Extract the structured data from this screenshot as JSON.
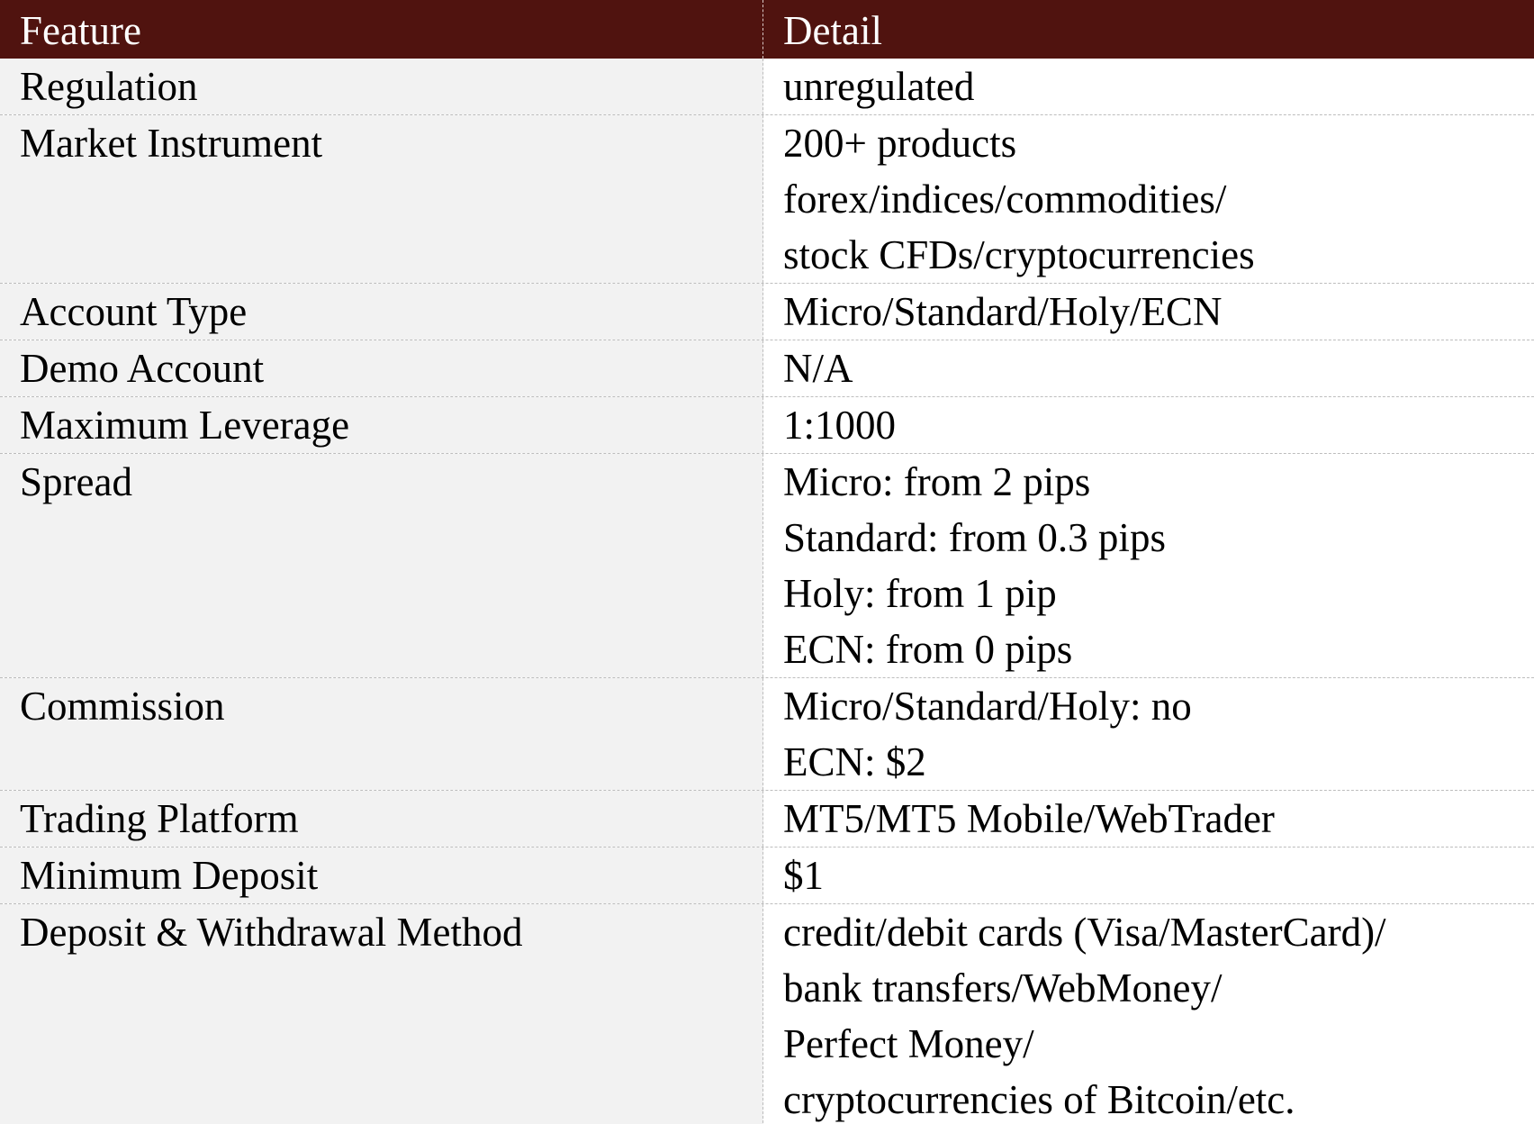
{
  "colors": {
    "header_bg": "#50130f",
    "header_text": "#ffffff",
    "feature_col_bg": "#f2f2f2",
    "detail_col_bg": "#ffffff",
    "divider": "#bdbdbd"
  },
  "header": {
    "feature": "Feature",
    "detail": "Detail"
  },
  "rows": [
    {
      "feature": "Regulation",
      "detail": [
        "unregulated"
      ]
    },
    {
      "feature": "Market Instrument",
      "detail": [
        "200+ products",
        "forex/indices/commodities/",
        "stock CFDs/cryptocurrencies"
      ]
    },
    {
      "feature": "Account Type",
      "detail": [
        "Micro/Standard/Holy/ECN"
      ]
    },
    {
      "feature": "Demo Account",
      "detail": [
        "N/A"
      ]
    },
    {
      "feature": "Maximum Leverage",
      "detail": [
        "1:1000"
      ]
    },
    {
      "feature": "Spread",
      "detail": [
        "Micro: from 2 pips",
        "Standard: from 0.3 pips",
        "Holy: from 1 pip",
        "ECN: from 0 pips"
      ]
    },
    {
      "feature": "Commission",
      "detail": [
        "Micro/Standard/Holy: no",
        "ECN: $2"
      ]
    },
    {
      "feature": "Trading Platform",
      "detail": [
        "MT5/MT5 Mobile/WebTrader"
      ]
    },
    {
      "feature": "Minimum Deposit",
      "detail": [
        "$1"
      ]
    },
    {
      "feature": "Deposit & Withdrawal Method",
      "detail": [
        "credit/debit cards (Visa/MasterCard)/",
        "bank transfers/WebMoney/",
        "Perfect Money/",
        "cryptocurrencies of Bitcoin/etc."
      ]
    }
  ]
}
